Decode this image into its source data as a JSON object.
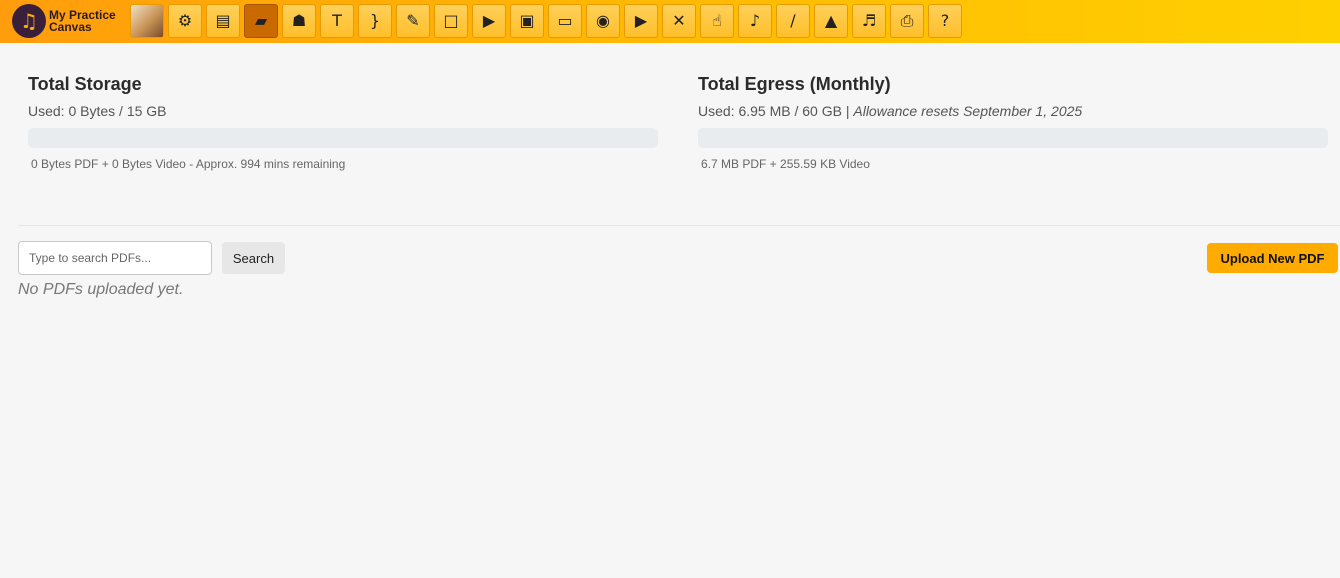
{
  "app": {
    "logo_glyph": "♫",
    "logo_line1": "My Practice",
    "logo_line2": "Canvas"
  },
  "toolbar": [
    {
      "name": "profile-photo-icon",
      "glyph": "",
      "active": false
    },
    {
      "name": "settings-gear-icon",
      "glyph": "⚙",
      "active": false
    },
    {
      "name": "stacked-sheets-icon",
      "glyph": "▤",
      "active": false
    },
    {
      "name": "folder-icon",
      "glyph": "▰",
      "active": true
    },
    {
      "name": "graduate-icon",
      "glyph": "☗",
      "active": false
    },
    {
      "name": "text-tool-icon",
      "glyph": "T",
      "active": false
    },
    {
      "name": "slur-tool-icon",
      "glyph": "}",
      "active": false
    },
    {
      "name": "marker-tool-icon",
      "glyph": "✎",
      "active": false
    },
    {
      "name": "rectangle-tool-icon",
      "glyph": "□",
      "active": false
    },
    {
      "name": "play-icon",
      "glyph": "▶",
      "active": false
    },
    {
      "name": "projector-icon",
      "glyph": "▣",
      "active": false
    },
    {
      "name": "monitor-icon",
      "glyph": "▭",
      "active": false
    },
    {
      "name": "circle-shape-icon",
      "glyph": "◉",
      "active": false
    },
    {
      "name": "youtube-icon",
      "glyph": "▶",
      "active": false
    },
    {
      "name": "close-x-icon",
      "glyph": "✕",
      "active": false
    },
    {
      "name": "pointing-hand-icon",
      "glyph": "☝",
      "active": false
    },
    {
      "name": "music-note-icon",
      "glyph": "♪",
      "active": false
    },
    {
      "name": "brush-icon",
      "glyph": "∕",
      "active": false
    },
    {
      "name": "metronome-icon",
      "glyph": "▲",
      "active": false
    },
    {
      "name": "guitar-icon",
      "glyph": "♬",
      "active": false
    },
    {
      "name": "printer-icon",
      "glyph": "⎙",
      "active": false
    },
    {
      "name": "help-question-icon",
      "glyph": "?",
      "active": false
    }
  ],
  "storage": {
    "title": "Total Storage",
    "used_text": "Used: 0 Bytes / 15 GB",
    "used_fraction": 0,
    "detail": "0 Bytes PDF + 0 Bytes Video - Approx. 994 mins remaining"
  },
  "egress": {
    "title": "Total Egress (Monthly)",
    "used_text": "Used: 6.95 MB / 60 GB | ",
    "used_note": "Allowance resets September 1, 2025",
    "used_fraction": 0.0001,
    "detail": "6.7 MB PDF + 255.59 KB Video"
  },
  "search": {
    "placeholder": "Type to search PDFs...",
    "value": "",
    "button_label": "Search"
  },
  "upload": {
    "label": "Upload New PDF"
  },
  "list": {
    "empty_text": "No PDFs uploaded yet."
  },
  "colors": {
    "accent": "#ffab00",
    "toolbar_start": "#ff9d0c",
    "toolbar_end": "#ffd000",
    "bar_track": "#e9ecef"
  }
}
